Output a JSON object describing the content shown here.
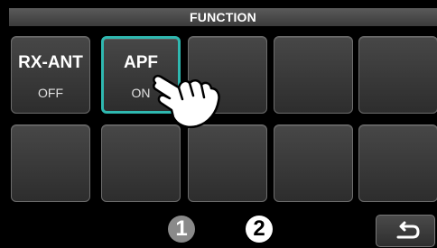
{
  "header": {
    "title": "FUNCTION"
  },
  "buttons": {
    "rx_ant": {
      "label": "RX-ANT",
      "state": "OFF"
    },
    "apf": {
      "label": "APF",
      "state": "ON"
    }
  },
  "callouts": {
    "one": "1",
    "two": "2"
  },
  "icons": {
    "back": "return-arrow-icon",
    "hand": "pointing-hand-icon"
  },
  "colors": {
    "accent": "#2fb8b0",
    "background": "#000000"
  }
}
